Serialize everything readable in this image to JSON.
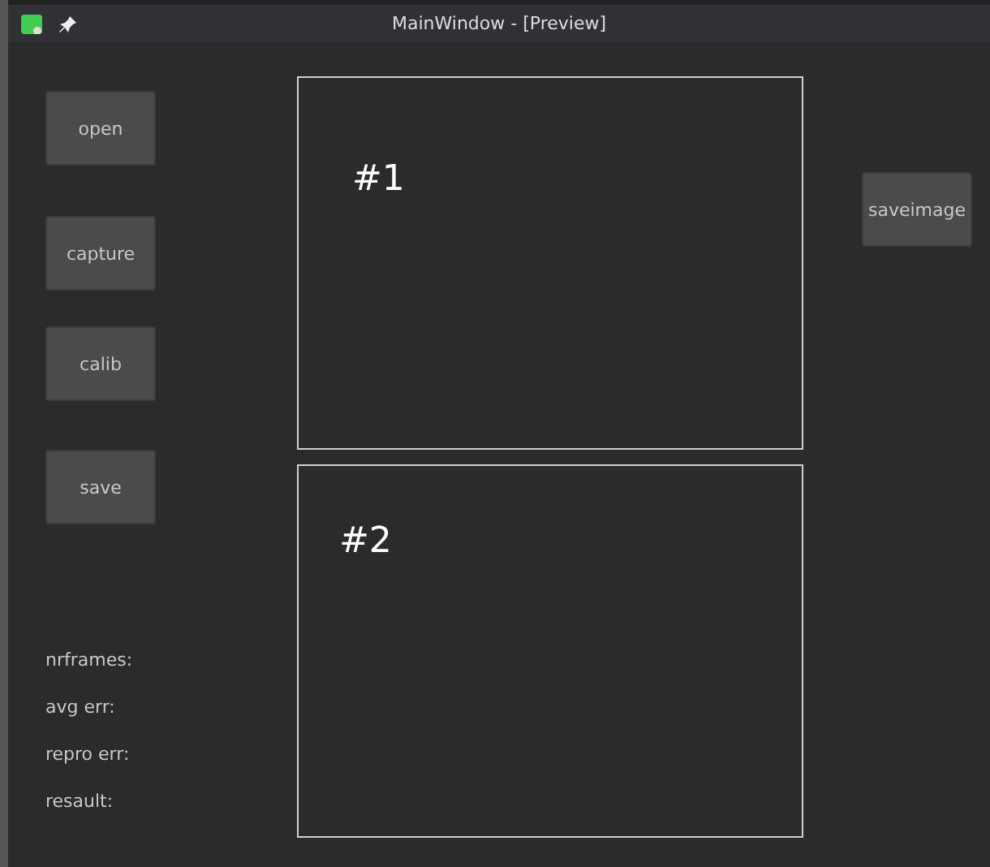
{
  "window": {
    "title": "MainWindow - [Preview]"
  },
  "left_buttons": [
    "open",
    "capture",
    "calib",
    "save"
  ],
  "status_labels": [
    "nrframes:",
    "avg err:",
    "repro err:",
    "resault:"
  ],
  "frames": [
    {
      "label": "#1"
    },
    {
      "label": "#2"
    }
  ],
  "right_buttons": [
    "saveimage"
  ]
}
